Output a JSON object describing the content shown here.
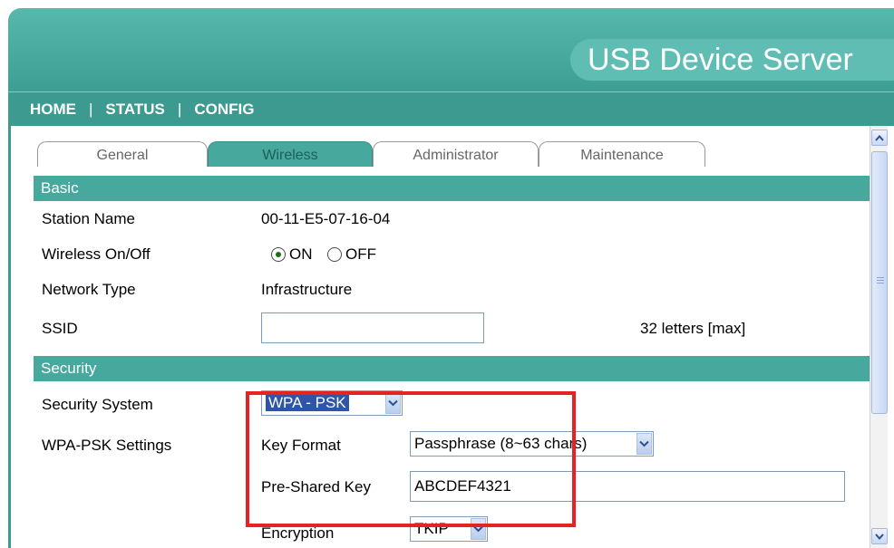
{
  "header": {
    "brand": "USB Device Server"
  },
  "nav": {
    "home": "HOME",
    "sep1": "|",
    "status": "STATUS",
    "sep2": "|",
    "config": "CONFIG"
  },
  "tabs": [
    {
      "label": "General",
      "active": false
    },
    {
      "label": "Wireless",
      "active": true
    },
    {
      "label": "Administrator",
      "active": false
    },
    {
      "label": "Maintenance",
      "active": false
    }
  ],
  "basic": {
    "section_title": "Basic",
    "station_name_label": "Station Name",
    "station_name_value": "00-11-E5-07-16-04",
    "wireless_label": "Wireless On/Off",
    "wireless_on": "ON",
    "wireless_off": "OFF",
    "wireless_selected": "ON",
    "network_type_label": "Network Type",
    "network_type_value": "Infrastructure",
    "ssid_label": "SSID",
    "ssid_value": "",
    "ssid_hint": "32 letters [max]"
  },
  "security": {
    "section_title": "Security",
    "system_label": "Security System",
    "system_value": "WPA - PSK",
    "wpa_settings_label": "WPA-PSK Settings",
    "key_format_label": "Key Format",
    "key_format_value": "Passphrase (8~63 chars)",
    "psk_label": "Pre-Shared Key",
    "psk_value": "ABCDEF4321",
    "encryption_label": "Encryption",
    "encryption_value": "TKIP"
  },
  "colors": {
    "accent": "#47a89e",
    "header": "#3c9a91",
    "highlight": "#e52323"
  },
  "icons": {
    "dropdown": "chevron-down-icon",
    "scroll_up": "arrow-up-icon",
    "scroll_down": "arrow-down-icon"
  }
}
